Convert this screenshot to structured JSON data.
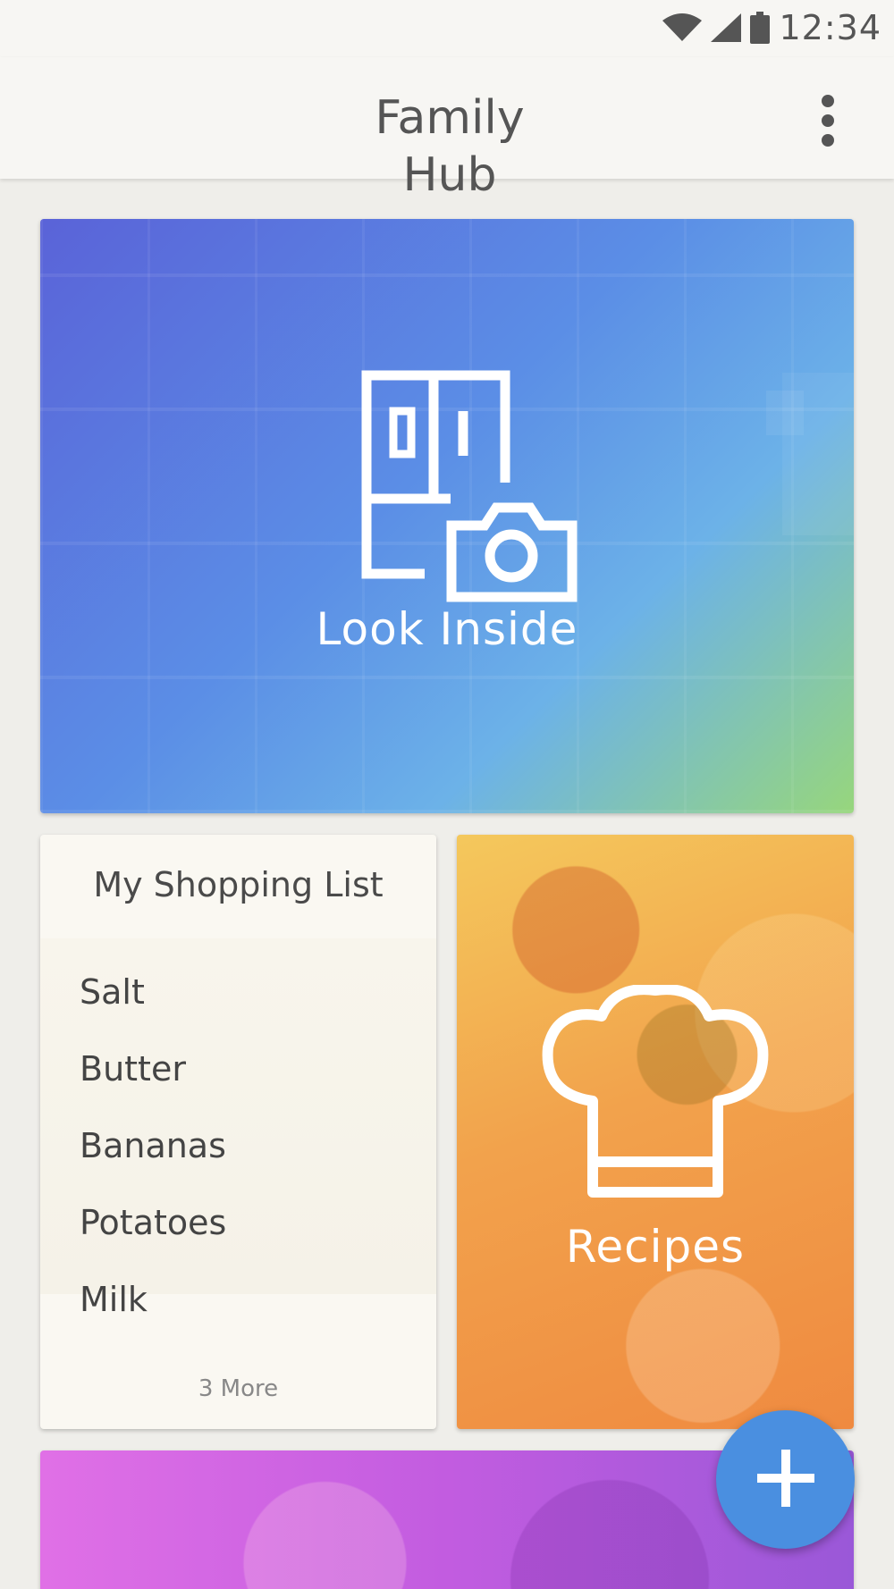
{
  "status_bar": {
    "time": "12:34",
    "icons": [
      "wifi-icon",
      "cellular-signal-icon",
      "battery-icon"
    ]
  },
  "app_bar": {
    "title": "Family Hub",
    "overflow_icon": "more-vert-icon"
  },
  "cards": {
    "look_inside": {
      "label": "Look Inside",
      "icon": "fridge-camera-icon"
    },
    "shopping_list": {
      "title": "My Shopping List",
      "items": [
        "Salt",
        "Butter",
        "Bananas",
        "Potatoes",
        "Milk"
      ],
      "more_label": "3 More"
    },
    "recipes": {
      "label": "Recipes",
      "icon": "chef-hat-icon"
    }
  },
  "fab": {
    "icon": "plus-icon"
  },
  "colors": {
    "fab": "#4a8fe0",
    "look_inside_gradient": [
      "#5a63d8",
      "#97d67c"
    ],
    "recipes_gradient": [
      "#f4c85c",
      "#ef8a40"
    ],
    "photo_gradient": [
      "#e070e6",
      "#9a58d8"
    ]
  }
}
